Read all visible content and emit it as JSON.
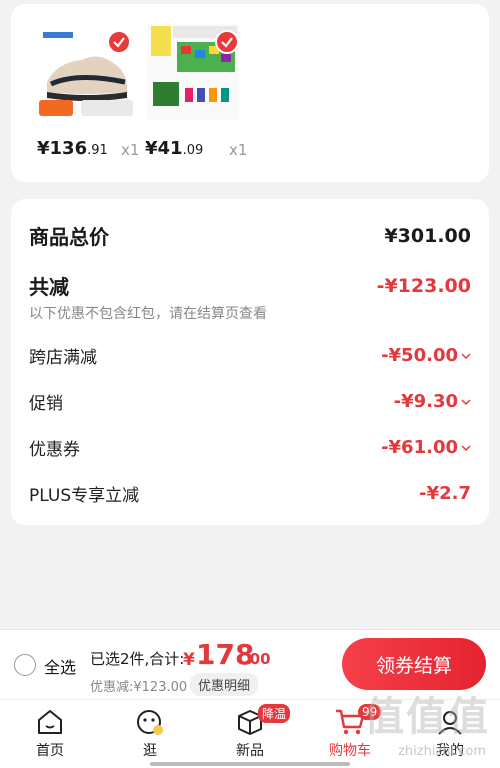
{
  "products": [
    {
      "price_main": "¥136",
      "price_cents": ".91",
      "qty": "x1",
      "image": "running-shoe",
      "checked": true
    },
    {
      "price_main": "¥41",
      "price_cents": ".09",
      "qty": "x1",
      "image": "building-blocks-box",
      "checked": true
    }
  ],
  "summary": {
    "total_label": "商品总价",
    "total_value": "¥301.00",
    "reduce_label": "共减",
    "reduce_value": "-¥123.00",
    "note": "以下优惠不包含红包，请在结算页查看",
    "items": [
      {
        "label": "跨店满减",
        "value": "-¥50.00",
        "expandable": true
      },
      {
        "label": "促销",
        "value": "-¥9.30",
        "expandable": true
      },
      {
        "label": "优惠券",
        "value": "-¥61.00",
        "expandable": true
      },
      {
        "label": "PLUS专享立减",
        "value": "-¥2.7",
        "expandable": false
      }
    ]
  },
  "bottom_bar": {
    "select_all": "全选",
    "selected_info": "已选2件,合计:",
    "total_symbol": "¥",
    "total_main": "178",
    "total_cents": ".00",
    "discount_line": "优惠减:¥123.00",
    "detail_button": "优惠明细",
    "checkout_button": "领券结算"
  },
  "tabbar": {
    "tabs": [
      {
        "label": "首页",
        "icon": "home-icon"
      },
      {
        "label": "逛",
        "icon": "mascot-icon"
      },
      {
        "label": "新品",
        "icon": "box-icon",
        "badge": "降温"
      },
      {
        "label": "购物车",
        "icon": "cart-icon",
        "badge": "99",
        "active": true
      },
      {
        "label": "我的",
        "icon": "user-icon"
      }
    ]
  },
  "watermark": "zhizhizhi.com",
  "colors": {
    "accent": "#e4393c",
    "background": "#f2f2f2"
  }
}
